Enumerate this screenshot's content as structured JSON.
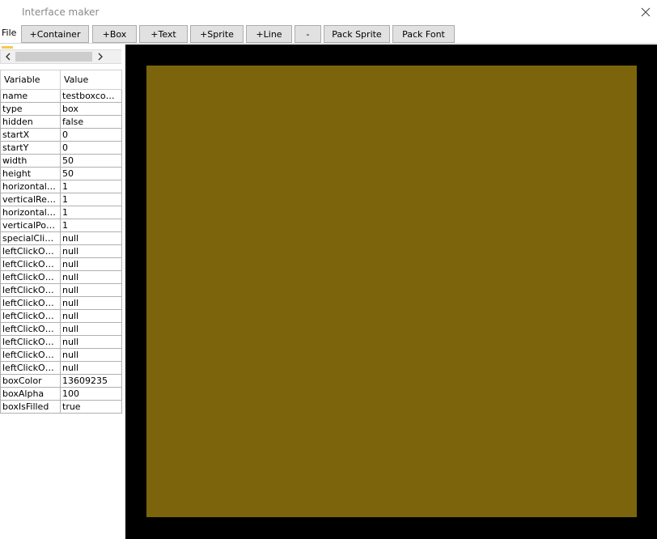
{
  "window": {
    "title": "Interface maker"
  },
  "menu": {
    "file_label": "File"
  },
  "toolbar": {
    "buttons": [
      {
        "id": "add-container",
        "label": "+Container"
      },
      {
        "id": "add-box",
        "label": "+Box"
      },
      {
        "id": "add-text",
        "label": "+Text"
      },
      {
        "id": "add-sprite",
        "label": "+Sprite"
      },
      {
        "id": "add-line",
        "label": "+Line"
      },
      {
        "id": "remove",
        "label": "-"
      },
      {
        "id": "pack-sprite",
        "label": "Pack Sprite"
      },
      {
        "id": "pack-font",
        "label": "Pack Font"
      }
    ]
  },
  "properties": {
    "headers": {
      "variable": "Variable",
      "value": "Value"
    },
    "rows": [
      {
        "variable": "name",
        "value": "testboxcom..."
      },
      {
        "variable": "type",
        "value": "box"
      },
      {
        "variable": "hidden",
        "value": "false"
      },
      {
        "variable": "startX",
        "value": "0"
      },
      {
        "variable": "startY",
        "value": "0"
      },
      {
        "variable": "width",
        "value": "50"
      },
      {
        "variable": "height",
        "value": "50"
      },
      {
        "variable": "horizontalRe...",
        "value": "1"
      },
      {
        "variable": "verticalResiz...",
        "value": "1"
      },
      {
        "variable": "horizontalPo...",
        "value": "1"
      },
      {
        "variable": "verticalPositi...",
        "value": "1"
      },
      {
        "variable": "specialClick...",
        "value": "null"
      },
      {
        "variable": "leftClickOpti...",
        "value": "null"
      },
      {
        "variable": "leftClickOpti...",
        "value": "null"
      },
      {
        "variable": "leftClickOpti...",
        "value": "null"
      },
      {
        "variable": "leftClickOpti...",
        "value": "null"
      },
      {
        "variable": "leftClickOpti...",
        "value": "null"
      },
      {
        "variable": "leftClickOpti...",
        "value": "null"
      },
      {
        "variable": "leftClickOpti...",
        "value": "null"
      },
      {
        "variable": "leftClickOpti...",
        "value": "null"
      },
      {
        "variable": "leftClickOpti...",
        "value": "null"
      },
      {
        "variable": "leftClickOpti...",
        "value": "null"
      },
      {
        "variable": "boxColor",
        "value": "13609235"
      },
      {
        "variable": "boxAlpha",
        "value": "100"
      },
      {
        "variable": "boxIsFilled",
        "value": "true"
      }
    ]
  },
  "canvas": {
    "background_color": "#000000",
    "box_color": "#7b640c"
  },
  "icons": {
    "close": "close-icon",
    "scroll_left": "chevron-left-icon",
    "scroll_right": "chevron-right-icon"
  }
}
